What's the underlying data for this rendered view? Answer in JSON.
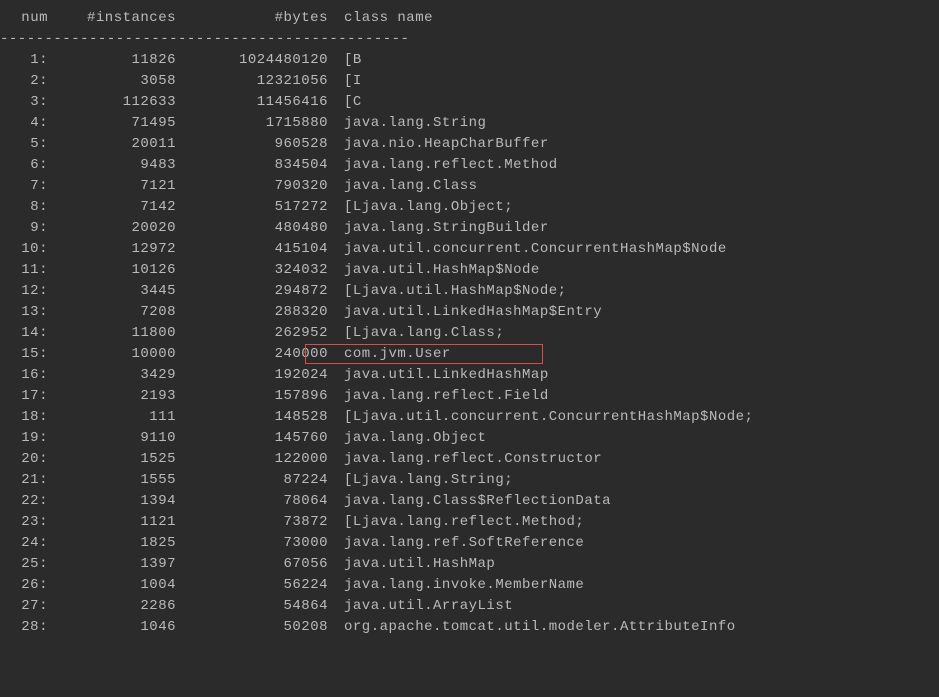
{
  "header": {
    "num": " num",
    "instances": "#instances",
    "bytes": "#bytes",
    "classname": "class name"
  },
  "separator": "----------------------------------------------",
  "highlight_row_index": 14,
  "rows": [
    {
      "num": "1:",
      "instances": "11826",
      "bytes": "1024480120",
      "classname": "[B"
    },
    {
      "num": "2:",
      "instances": "3058",
      "bytes": "12321056",
      "classname": "[I"
    },
    {
      "num": "3:",
      "instances": "112633",
      "bytes": "11456416",
      "classname": "[C"
    },
    {
      "num": "4:",
      "instances": "71495",
      "bytes": "1715880",
      "classname": "java.lang.String"
    },
    {
      "num": "5:",
      "instances": "20011",
      "bytes": "960528",
      "classname": "java.nio.HeapCharBuffer"
    },
    {
      "num": "6:",
      "instances": "9483",
      "bytes": "834504",
      "classname": "java.lang.reflect.Method"
    },
    {
      "num": "7:",
      "instances": "7121",
      "bytes": "790320",
      "classname": "java.lang.Class"
    },
    {
      "num": "8:",
      "instances": "7142",
      "bytes": "517272",
      "classname": "[Ljava.lang.Object;"
    },
    {
      "num": "9:",
      "instances": "20020",
      "bytes": "480480",
      "classname": "java.lang.StringBuilder"
    },
    {
      "num": "10:",
      "instances": "12972",
      "bytes": "415104",
      "classname": "java.util.concurrent.ConcurrentHashMap$Node"
    },
    {
      "num": "11:",
      "instances": "10126",
      "bytes": "324032",
      "classname": "java.util.HashMap$Node"
    },
    {
      "num": "12:",
      "instances": "3445",
      "bytes": "294872",
      "classname": "[Ljava.util.HashMap$Node;"
    },
    {
      "num": "13:",
      "instances": "7208",
      "bytes": "288320",
      "classname": "java.util.LinkedHashMap$Entry"
    },
    {
      "num": "14:",
      "instances": "11800",
      "bytes": "262952",
      "classname": "[Ljava.lang.Class;"
    },
    {
      "num": "15:",
      "instances": "10000",
      "bytes": "240000",
      "classname": "com.jvm.User"
    },
    {
      "num": "16:",
      "instances": "3429",
      "bytes": "192024",
      "classname": "java.util.LinkedHashMap"
    },
    {
      "num": "17:",
      "instances": "2193",
      "bytes": "157896",
      "classname": "java.lang.reflect.Field"
    },
    {
      "num": "18:",
      "instances": "111",
      "bytes": "148528",
      "classname": "[Ljava.util.concurrent.ConcurrentHashMap$Node;"
    },
    {
      "num": "19:",
      "instances": "9110",
      "bytes": "145760",
      "classname": "java.lang.Object"
    },
    {
      "num": "20:",
      "instances": "1525",
      "bytes": "122000",
      "classname": "java.lang.reflect.Constructor"
    },
    {
      "num": "21:",
      "instances": "1555",
      "bytes": "87224",
      "classname": "[Ljava.lang.String;"
    },
    {
      "num": "22:",
      "instances": "1394",
      "bytes": "78064",
      "classname": "java.lang.Class$ReflectionData"
    },
    {
      "num": "23:",
      "instances": "1121",
      "bytes": "73872",
      "classname": "[Ljava.lang.reflect.Method;"
    },
    {
      "num": "24:",
      "instances": "1825",
      "bytes": "73000",
      "classname": "java.lang.ref.SoftReference"
    },
    {
      "num": "25:",
      "instances": "1397",
      "bytes": "67056",
      "classname": "java.util.HashMap"
    },
    {
      "num": "26:",
      "instances": "1004",
      "bytes": "56224",
      "classname": "java.lang.invoke.MemberName"
    },
    {
      "num": "27:",
      "instances": "2286",
      "bytes": "54864",
      "classname": "java.util.ArrayList"
    },
    {
      "num": "28:",
      "instances": "1046",
      "bytes": "50208",
      "classname": "org.apache.tomcat.util.modeler.AttributeInfo"
    }
  ]
}
